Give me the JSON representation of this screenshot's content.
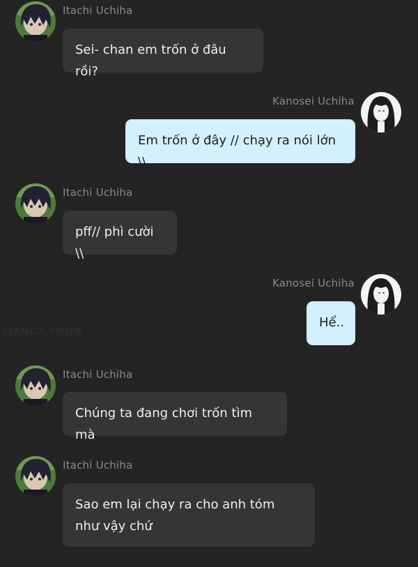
{
  "chat": {
    "messages": [
      {
        "sender": "Itachi Uchiha",
        "side": "incoming",
        "text": "Sei- chan em trốn ở đâu rồi?",
        "avatar_icon": "itachi-avatar"
      },
      {
        "sender": "Kanosei Uchiha",
        "side": "outgoing",
        "text": "Em trốn ở đây // chạy ra nói lớn \\\\",
        "avatar_icon": "kanosei-avatar"
      },
      {
        "sender": "Itachi Uchiha",
        "side": "incoming",
        "text": "pff// phì cười \\\\",
        "avatar_icon": "itachi-avatar"
      },
      {
        "sender": "Kanosei Uchiha",
        "side": "outgoing",
        "text": "Hể..",
        "avatar_icon": "kanosei-avatar"
      },
      {
        "sender": "Itachi Uchiha",
        "side": "incoming",
        "text": "Chúng ta đang chơi trốn tìm mà",
        "avatar_icon": "itachi-avatar"
      },
      {
        "sender": "Itachi Uchiha",
        "side": "incoming",
        "text": "Sao em lại chạy ra cho anh tóm như vậy chứ",
        "avatar_icon": "itachi-avatar"
      }
    ]
  },
  "watermark": {
    "text": "MANGA TOON"
  },
  "colors": {
    "background": "#242424",
    "incoming_bubble": "#353535",
    "outgoing_bubble": "#d2f0fd",
    "name_text": "#8a8a8a"
  }
}
